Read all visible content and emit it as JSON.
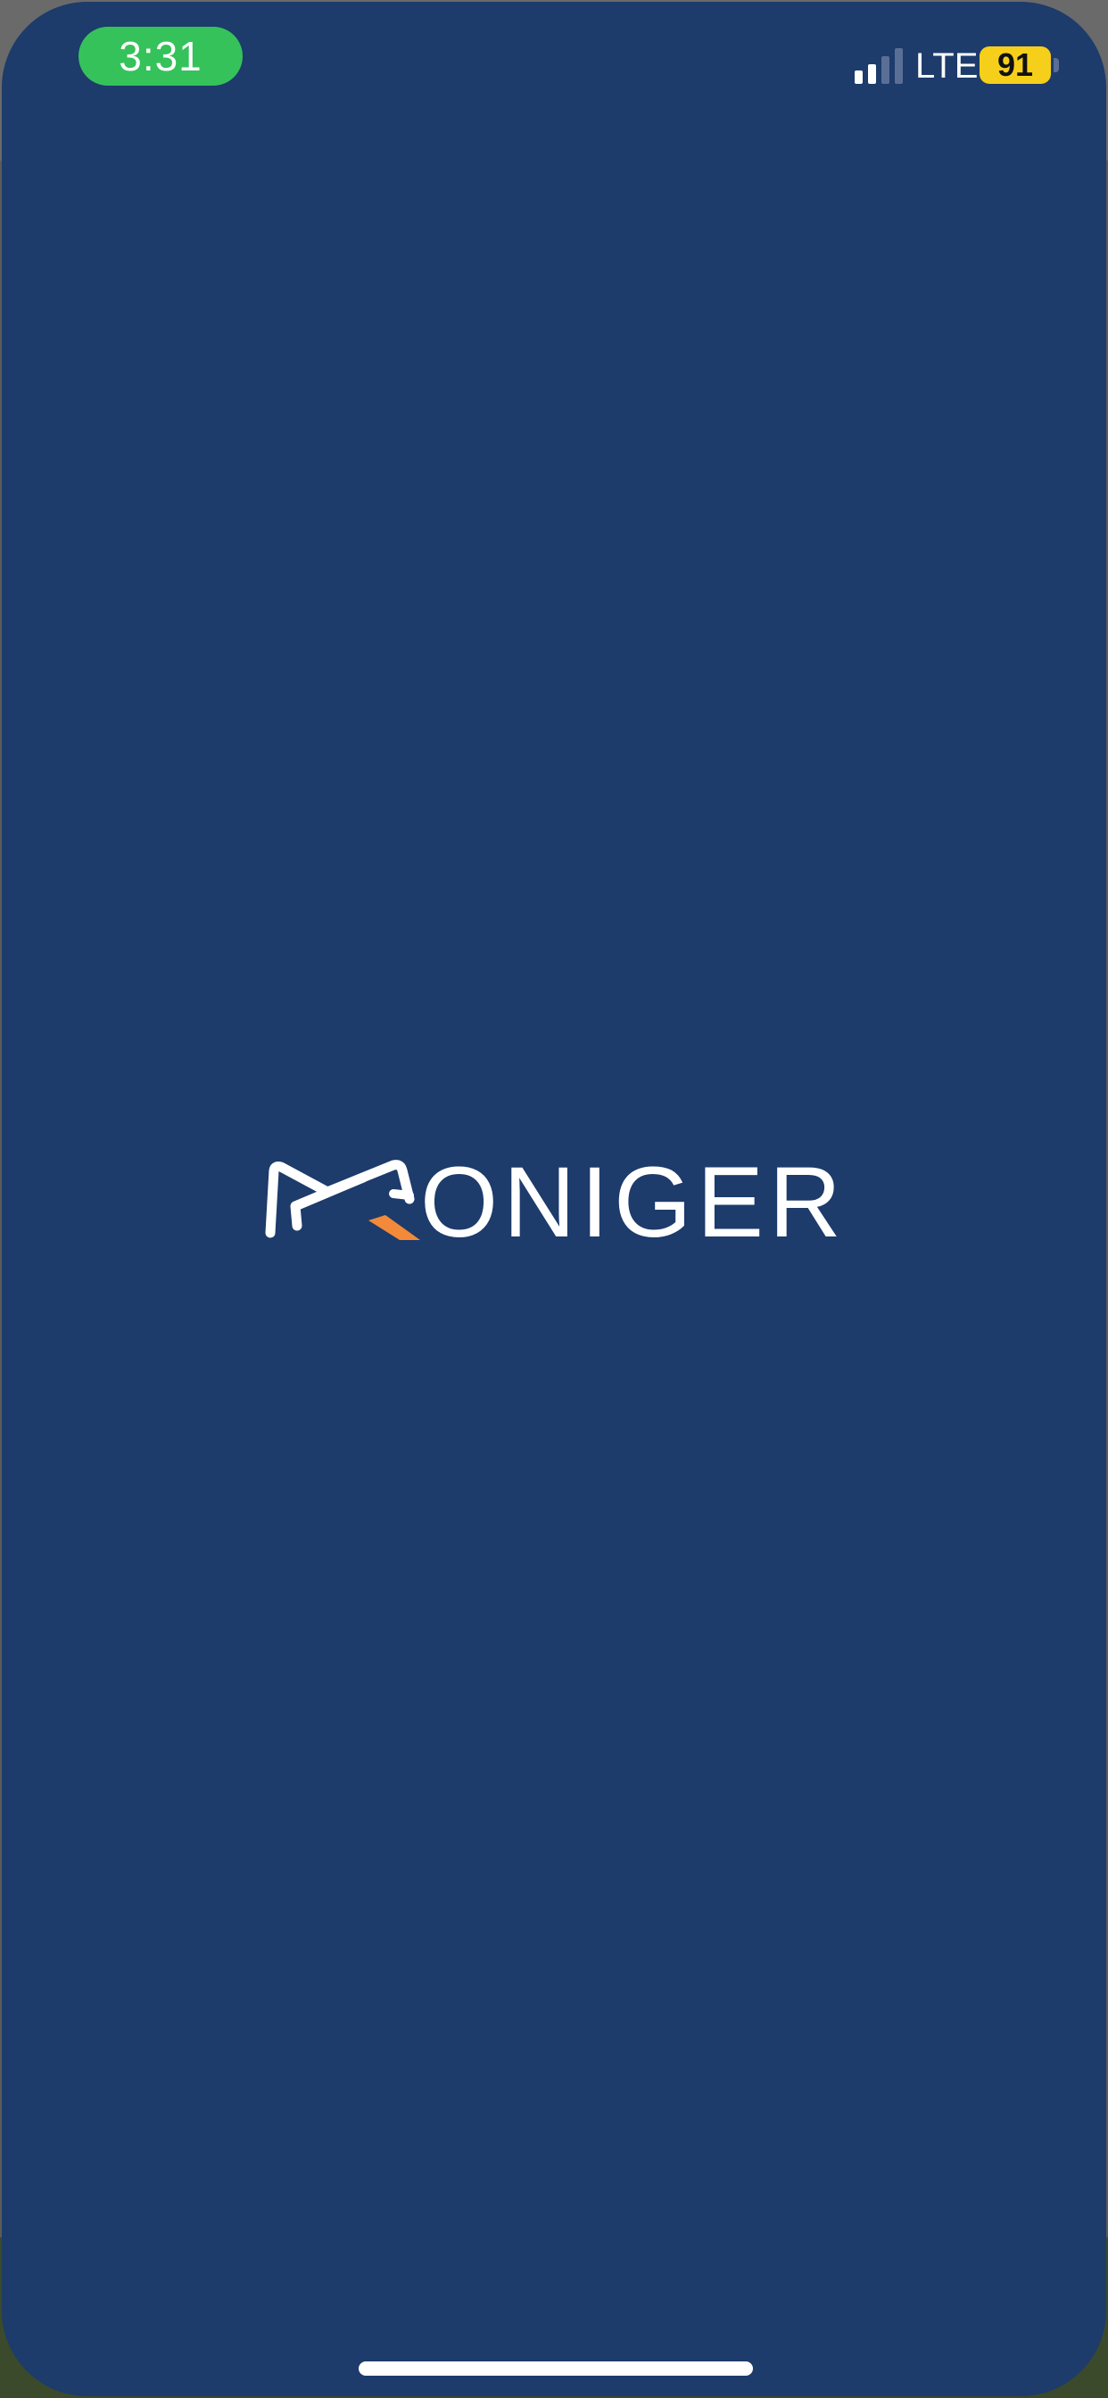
{
  "status_bar": {
    "time": "3:31",
    "network": "LTE",
    "battery": "91",
    "signal_icon": "cellular-signal-icon",
    "battery_icon": "battery-icon"
  },
  "splash": {
    "logo_text": "MONIGER",
    "logo_wordmark_rest": "ONIGER",
    "logo_icon": "moniger-logo-icon"
  },
  "colors": {
    "background": "#1d3b6b",
    "time_pill": "#35c25a",
    "battery": "#f6cf1b",
    "logo_accent": "#f28a3a",
    "logo_text": "#ffffff"
  }
}
